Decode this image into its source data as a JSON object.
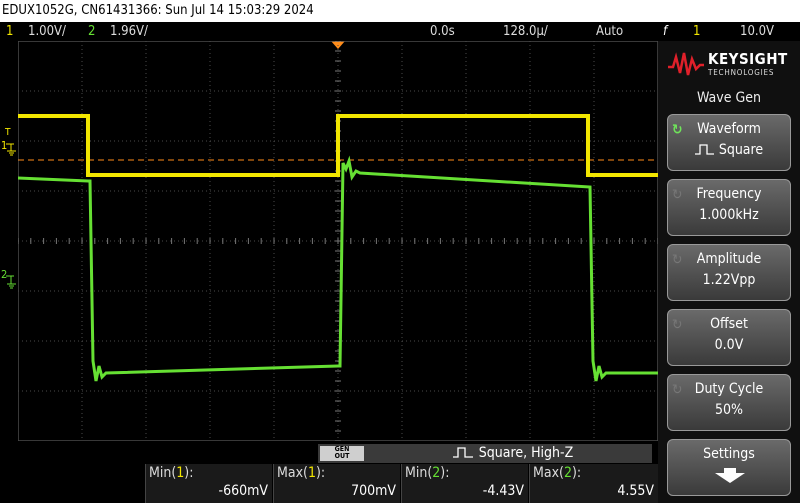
{
  "title": "EDUX1052G, CN61431366: Sun Jul 14 15:03:29 2024",
  "status": {
    "ch1_num": "1",
    "ch1_scale": "1.00V/",
    "ch2_num": "2",
    "ch2_scale": "1.96V/",
    "delay": "0.0s",
    "timebase": "128.0µ/",
    "trigger_mode": "Auto",
    "trigger_icon": "f",
    "trigger_ch": "1",
    "trigger_level": "10.0V"
  },
  "markers": {
    "ch1": "T",
    "ch1_num": "1",
    "ch2_num": "2"
  },
  "side": {
    "brand": "KEYSIGHT",
    "brand_sub": "TECHNOLOGIES",
    "menu_title": "Wave Gen",
    "softkeys": [
      {
        "label": "Waveform",
        "value": "Square"
      },
      {
        "label": "Frequency",
        "value": "1.000kHz"
      },
      {
        "label": "Amplitude",
        "value": "1.22Vpp"
      },
      {
        "label": "Offset",
        "value": "0.0V"
      },
      {
        "label": "Duty Cycle",
        "value": "50%"
      },
      {
        "label": "Settings",
        "value": ""
      }
    ]
  },
  "wavegen": {
    "badge_top": "GEN",
    "badge_bottom": "OUT",
    "text": "Square, High-Z"
  },
  "measurements": [
    {
      "label": "Min(1):",
      "value": "-660mV"
    },
    {
      "label": "Max(1):",
      "value": "700mV"
    },
    {
      "label": "Min(2):",
      "value": "-4.43V"
    },
    {
      "label": "Max(2):",
      "value": "4.55V"
    }
  ],
  "colors": {
    "ch1": "#f2e600",
    "ch2": "#66e033",
    "trigger": "#ff8c1a",
    "grid": "#555555"
  }
}
